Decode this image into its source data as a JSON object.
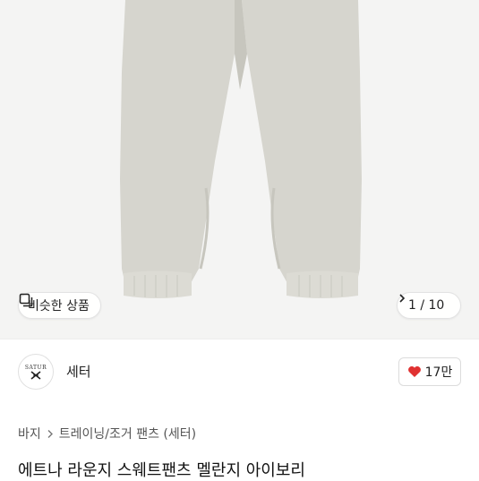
{
  "product_image": {
    "alt_subject": "ivory sweatpants",
    "colors": {
      "background": "#f4f4f3",
      "fabric": "#d6d5ce",
      "shadow": "#c7c6be"
    }
  },
  "similar_button": {
    "label": "비슷한 상품",
    "icon": "similar-items-icon"
  },
  "pager": {
    "label": "1 / 10",
    "icon": "chevron-right-icon"
  },
  "seller": {
    "name": "세터",
    "avatar_text": "SATUR",
    "avatar_icon": "crossed-logo-icon"
  },
  "like": {
    "count": "17만",
    "icon": "heart-icon",
    "color": "#e03131"
  },
  "breadcrumb": {
    "items": [
      "바지",
      "트레이닝/조거 팬츠 (세터)"
    ],
    "separator_icon": "chevron-right-icon"
  },
  "product": {
    "title": "에트나 라운지 스웨트팬츠 멜란지 아이보리"
  }
}
